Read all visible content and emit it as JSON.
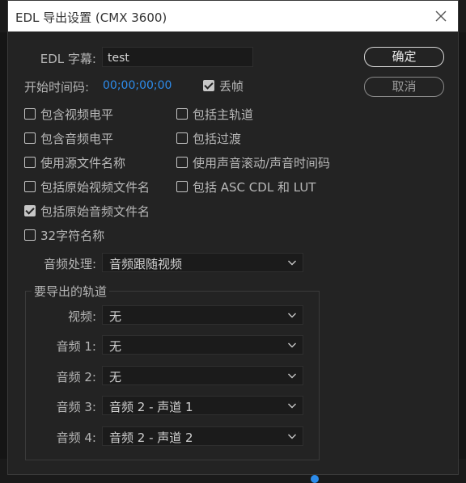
{
  "window": {
    "title": "EDL 导出设置 (CMX 3600)",
    "close_icon": "close-icon"
  },
  "edl_title": {
    "label": "EDL 字幕:",
    "value": "test"
  },
  "start_timecode": {
    "label": "开始时间码:",
    "value": "00;00;00;00"
  },
  "drop_frame": {
    "label": "丢帧",
    "checked": true
  },
  "buttons": {
    "ok": "确定",
    "cancel": "取消"
  },
  "options_left": [
    {
      "label": "包含视频电平",
      "checked": false
    },
    {
      "label": "包含音频电平",
      "checked": false
    },
    {
      "label": "使用源文件名称",
      "checked": false
    },
    {
      "label": "包括原始视频文件名",
      "checked": false
    },
    {
      "label": "包括原始音频文件名",
      "checked": true
    },
    {
      "label": "32字符名称",
      "checked": false
    }
  ],
  "options_right": [
    {
      "label": "包括主轨道",
      "checked": false
    },
    {
      "label": "包括过渡",
      "checked": false
    },
    {
      "label": "使用声音滚动/声音时间码",
      "checked": false
    },
    {
      "label": "包括 ASC CDL 和 LUT",
      "checked": false
    }
  ],
  "audio_processing": {
    "label": "音频处理:",
    "value": "音频跟随视频"
  },
  "tracks": {
    "title": "要导出的轨道",
    "video": {
      "label": "视频:",
      "value": "无"
    },
    "audio1": {
      "label": "音频 1:",
      "value": "无"
    },
    "audio2": {
      "label": "音频 2:",
      "value": "无"
    },
    "audio3": {
      "label": "音频 3:",
      "value": "音频 2 - 声道 1"
    },
    "audio4": {
      "label": "音频 4:",
      "value": "音频 2 - 声道 2"
    }
  },
  "colors": {
    "accent": "#2d8ceb",
    "panel": "#232323",
    "field": "#1a1a1a"
  }
}
